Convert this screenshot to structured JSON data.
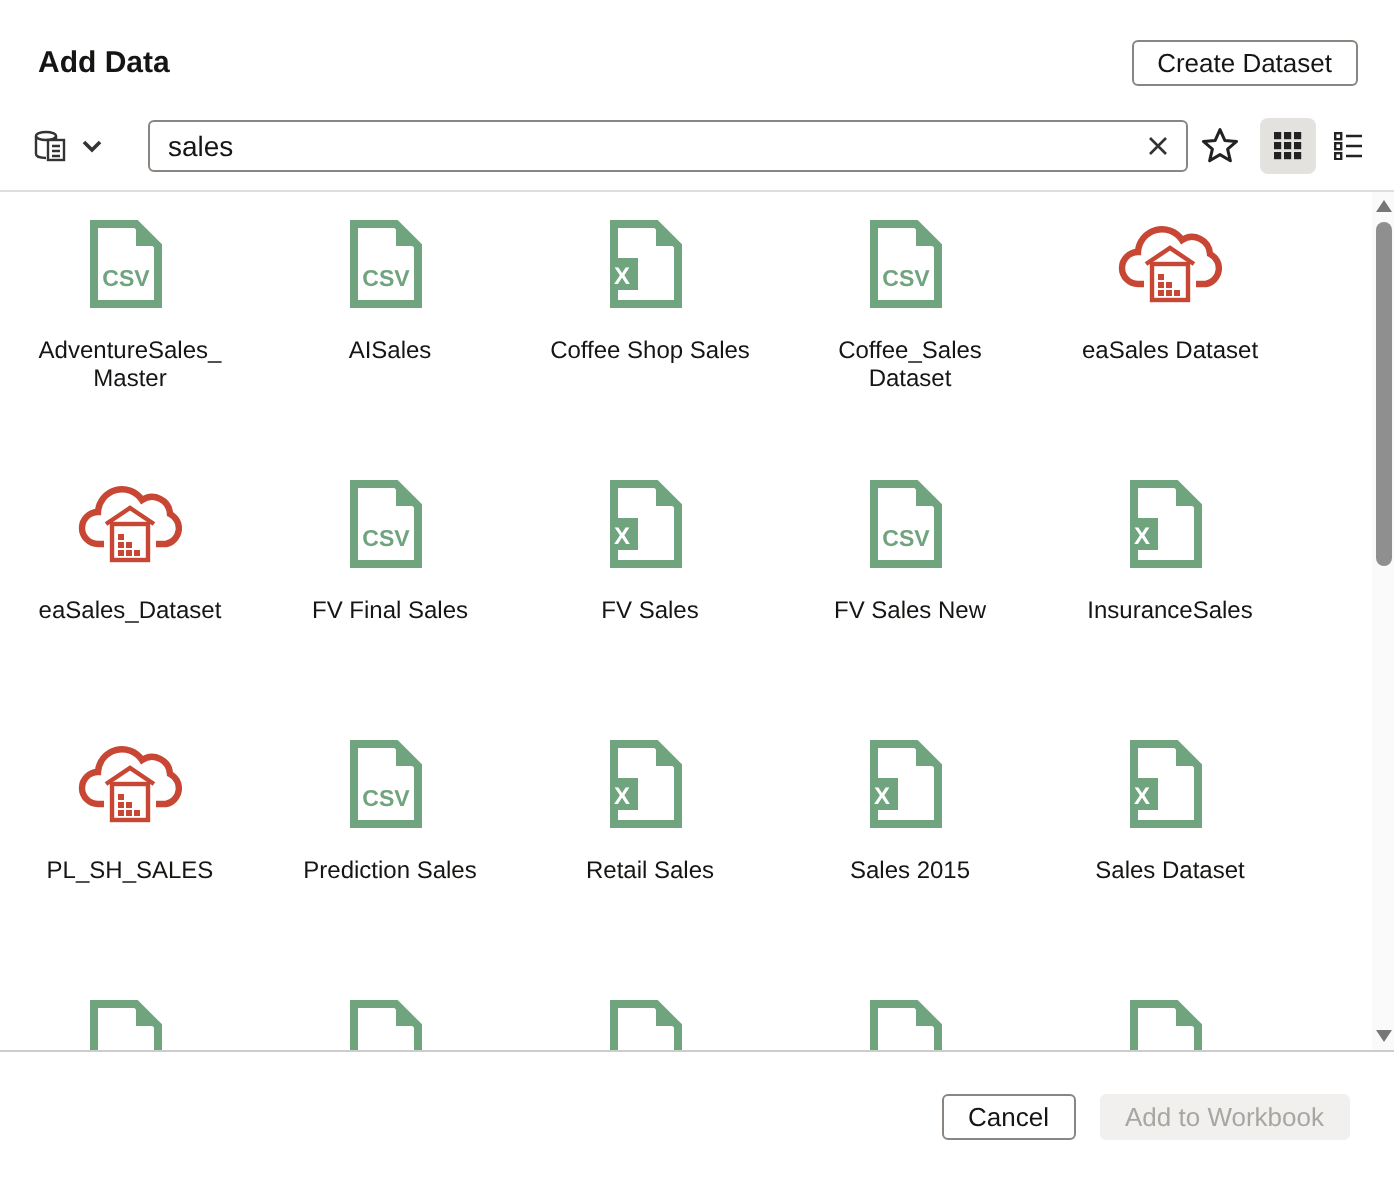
{
  "dialog": {
    "title": "Add Data",
    "create_button": "Create Dataset"
  },
  "toolbar": {
    "search": {
      "value": "sales"
    },
    "favorite": false,
    "views": [
      {
        "kind": "grid",
        "selected": true
      },
      {
        "kind": "list",
        "selected": false
      }
    ]
  },
  "items": [
    {
      "kind": "csv",
      "badge": "CSV",
      "name": "AdventureSales_ Master"
    },
    {
      "kind": "csv",
      "badge": "CSV",
      "name": "AISales"
    },
    {
      "kind": "excel",
      "badge": "X",
      "name": "Coffee Shop Sales"
    },
    {
      "kind": "csv",
      "badge": "CSV",
      "name": "Coffee_Sales Dataset"
    },
    {
      "kind": "cloud",
      "name": "eaSales Dataset"
    },
    {
      "kind": "cloud",
      "name": "eaSales_Dataset"
    },
    {
      "kind": "csv",
      "badge": "CSV",
      "name": "FV Final Sales"
    },
    {
      "kind": "excel",
      "badge": "X",
      "name": "FV Sales"
    },
    {
      "kind": "csv",
      "badge": "CSV",
      "name": "FV Sales New"
    },
    {
      "kind": "excel",
      "badge": "X",
      "name": "InsuranceSales"
    },
    {
      "kind": "cloud",
      "name": "PL_SH_SALES"
    },
    {
      "kind": "csv",
      "badge": "CSV",
      "name": "Prediction Sales"
    },
    {
      "kind": "excel",
      "badge": "X",
      "name": "Retail Sales"
    },
    {
      "kind": "excel",
      "badge": "X",
      "name": "Sales 2015"
    },
    {
      "kind": "excel",
      "badge": "X",
      "name": "Sales Dataset"
    },
    {
      "kind": "file"
    },
    {
      "kind": "file"
    },
    {
      "kind": "file"
    },
    {
      "kind": "file"
    },
    {
      "kind": "file"
    }
  ],
  "footer": {
    "buttons": [
      {
        "label": "Cancel",
        "disabled": false
      },
      {
        "label": "Add to Workbook",
        "disabled": true
      }
    ]
  }
}
